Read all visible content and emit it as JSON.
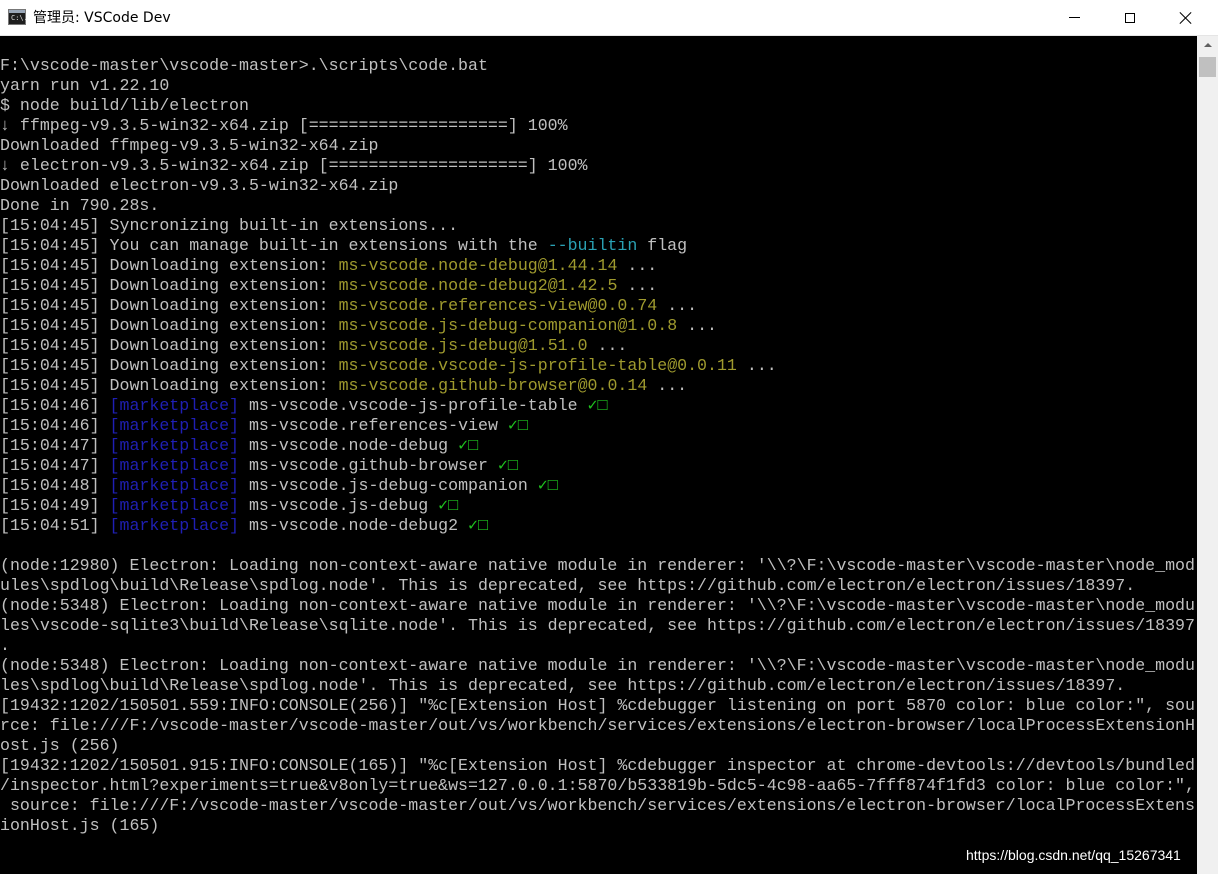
{
  "window": {
    "title": "管理员: VSCode Dev",
    "icon": "console-icon",
    "icon_text": "C:\\."
  },
  "colors": {
    "default": "#c0c0c0",
    "extension": "#9f9a2e",
    "flag": "#2aa1b3",
    "marketplace": "#1f1fb4",
    "check": "#1ec21e"
  },
  "console": {
    "lines": [
      [
        {
          "t": "F:\\vscode-master\\vscode-master>.\\scripts\\code.bat",
          "c": "default"
        }
      ],
      [
        {
          "t": "yarn run v1.22.10",
          "c": "default"
        }
      ],
      [
        {
          "t": "$ node build/lib/electron",
          "c": "default"
        }
      ],
      [
        {
          "t": "↓ ffmpeg-v9.3.5-win32-x64.zip [====================] 100%",
          "c": "default"
        }
      ],
      [
        {
          "t": "Downloaded ffmpeg-v9.3.5-win32-x64.zip",
          "c": "default"
        }
      ],
      [
        {
          "t": "↓ electron-v9.3.5-win32-x64.zip [====================] 100%",
          "c": "default"
        }
      ],
      [
        {
          "t": "Downloaded electron-v9.3.5-win32-x64.zip",
          "c": "default"
        }
      ],
      [
        {
          "t": "Done in 790.28s.",
          "c": "default"
        }
      ],
      [
        {
          "t": "[15:04:45] Syncronizing built-in extensions...",
          "c": "default"
        }
      ],
      [
        {
          "t": "[15:04:45] You can manage built-in extensions with the ",
          "c": "default"
        },
        {
          "t": "--builtin",
          "c": "flag"
        },
        {
          "t": " flag",
          "c": "default"
        }
      ],
      [
        {
          "t": "[15:04:45] Downloading extension: ",
          "c": "default"
        },
        {
          "t": "ms-vscode.node-debug@1.44.14",
          "c": "ext"
        },
        {
          "t": " ...",
          "c": "default"
        }
      ],
      [
        {
          "t": "[15:04:45] Downloading extension: ",
          "c": "default"
        },
        {
          "t": "ms-vscode.node-debug2@1.42.5",
          "c": "ext"
        },
        {
          "t": " ...",
          "c": "default"
        }
      ],
      [
        {
          "t": "[15:04:45] Downloading extension: ",
          "c": "default"
        },
        {
          "t": "ms-vscode.references-view@0.0.74",
          "c": "ext"
        },
        {
          "t": " ...",
          "c": "default"
        }
      ],
      [
        {
          "t": "[15:04:45] Downloading extension: ",
          "c": "default"
        },
        {
          "t": "ms-vscode.js-debug-companion@1.0.8",
          "c": "ext"
        },
        {
          "t": " ...",
          "c": "default"
        }
      ],
      [
        {
          "t": "[15:04:45] Downloading extension: ",
          "c": "default"
        },
        {
          "t": "ms-vscode.js-debug@1.51.0",
          "c": "ext"
        },
        {
          "t": " ...",
          "c": "default"
        }
      ],
      [
        {
          "t": "[15:04:45] Downloading extension: ",
          "c": "default"
        },
        {
          "t": "ms-vscode.vscode-js-profile-table@0.0.11",
          "c": "ext"
        },
        {
          "t": " ...",
          "c": "default"
        }
      ],
      [
        {
          "t": "[15:04:45] Downloading extension: ",
          "c": "default"
        },
        {
          "t": "ms-vscode.github-browser@0.0.14",
          "c": "ext"
        },
        {
          "t": " ...",
          "c": "default"
        }
      ],
      [
        {
          "t": "[15:04:46] ",
          "c": "default"
        },
        {
          "t": "[marketplace]",
          "c": "market"
        },
        {
          "t": " ms-vscode.vscode-js-profile-table ",
          "c": "default"
        },
        {
          "t": "✓□",
          "c": "check"
        }
      ],
      [
        {
          "t": "[15:04:46] ",
          "c": "default"
        },
        {
          "t": "[marketplace]",
          "c": "market"
        },
        {
          "t": " ms-vscode.references-view ",
          "c": "default"
        },
        {
          "t": "✓□",
          "c": "check"
        }
      ],
      [
        {
          "t": "[15:04:47] ",
          "c": "default"
        },
        {
          "t": "[marketplace]",
          "c": "market"
        },
        {
          "t": " ms-vscode.node-debug ",
          "c": "default"
        },
        {
          "t": "✓□",
          "c": "check"
        }
      ],
      [
        {
          "t": "[15:04:47] ",
          "c": "default"
        },
        {
          "t": "[marketplace]",
          "c": "market"
        },
        {
          "t": " ms-vscode.github-browser ",
          "c": "default"
        },
        {
          "t": "✓□",
          "c": "check"
        }
      ],
      [
        {
          "t": "[15:04:48] ",
          "c": "default"
        },
        {
          "t": "[marketplace]",
          "c": "market"
        },
        {
          "t": " ms-vscode.js-debug-companion ",
          "c": "default"
        },
        {
          "t": "✓□",
          "c": "check"
        }
      ],
      [
        {
          "t": "[15:04:49] ",
          "c": "default"
        },
        {
          "t": "[marketplace]",
          "c": "market"
        },
        {
          "t": " ms-vscode.js-debug ",
          "c": "default"
        },
        {
          "t": "✓□",
          "c": "check"
        }
      ],
      [
        {
          "t": "[15:04:51] ",
          "c": "default"
        },
        {
          "t": "[marketplace]",
          "c": "market"
        },
        {
          "t": " ms-vscode.node-debug2 ",
          "c": "default"
        },
        {
          "t": "✓□",
          "c": "check"
        }
      ],
      [
        {
          "t": "",
          "c": "default"
        }
      ],
      [
        {
          "t": "(node:12980) Electron: Loading non-context-aware native module in renderer: '\\\\?\\F:\\vscode-master\\vscode-master\\node_mod",
          "c": "default"
        }
      ],
      [
        {
          "t": "ules\\spdlog\\build\\Release\\spdlog.node'. This is deprecated, see https://github.com/electron/electron/issues/18397.",
          "c": "default"
        }
      ],
      [
        {
          "t": "(node:5348) Electron: Loading non-context-aware native module in renderer: '\\\\?\\F:\\vscode-master\\vscode-master\\node_modu",
          "c": "default"
        }
      ],
      [
        {
          "t": "les\\vscode-sqlite3\\build\\Release\\sqlite.node'. This is deprecated, see https://github.com/electron/electron/issues/18397",
          "c": "default"
        }
      ],
      [
        {
          "t": ".",
          "c": "default"
        }
      ],
      [
        {
          "t": "(node:5348) Electron: Loading non-context-aware native module in renderer: '\\\\?\\F:\\vscode-master\\vscode-master\\node_modu",
          "c": "default"
        }
      ],
      [
        {
          "t": "les\\spdlog\\build\\Release\\spdlog.node'. This is deprecated, see https://github.com/electron/electron/issues/18397.",
          "c": "default"
        }
      ],
      [
        {
          "t": "[19432:1202/150501.559:INFO:CONSOLE(256)] \"%c[Extension Host] %cdebugger listening on port 5870 color: blue color:\", sou",
          "c": "default"
        }
      ],
      [
        {
          "t": "rce: file:///F:/vscode-master/vscode-master/out/vs/workbench/services/extensions/electron-browser/localProcessExtensionH",
          "c": "default"
        }
      ],
      [
        {
          "t": "ost.js (256)",
          "c": "default"
        }
      ],
      [
        {
          "t": "[19432:1202/150501.915:INFO:CONSOLE(165)] \"%c[Extension Host] %cdebugger inspector at chrome-devtools://devtools/bundled",
          "c": "default"
        }
      ],
      [
        {
          "t": "/inspector.html?experiments=true&v8only=true&ws=127.0.0.1:5870/b533819b-5dc5-4c98-aa65-7fff874f1fd3 color: blue color:\",",
          "c": "default"
        }
      ],
      [
        {
          "t": " source: file:///F:/vscode-master/vscode-master/out/vs/workbench/services/extensions/electron-browser/localProcessExtens",
          "c": "default"
        }
      ],
      [
        {
          "t": "ionHost.js (165)",
          "c": "default"
        }
      ]
    ]
  },
  "watermark": "https://blog.csdn.net/qq_15267341"
}
